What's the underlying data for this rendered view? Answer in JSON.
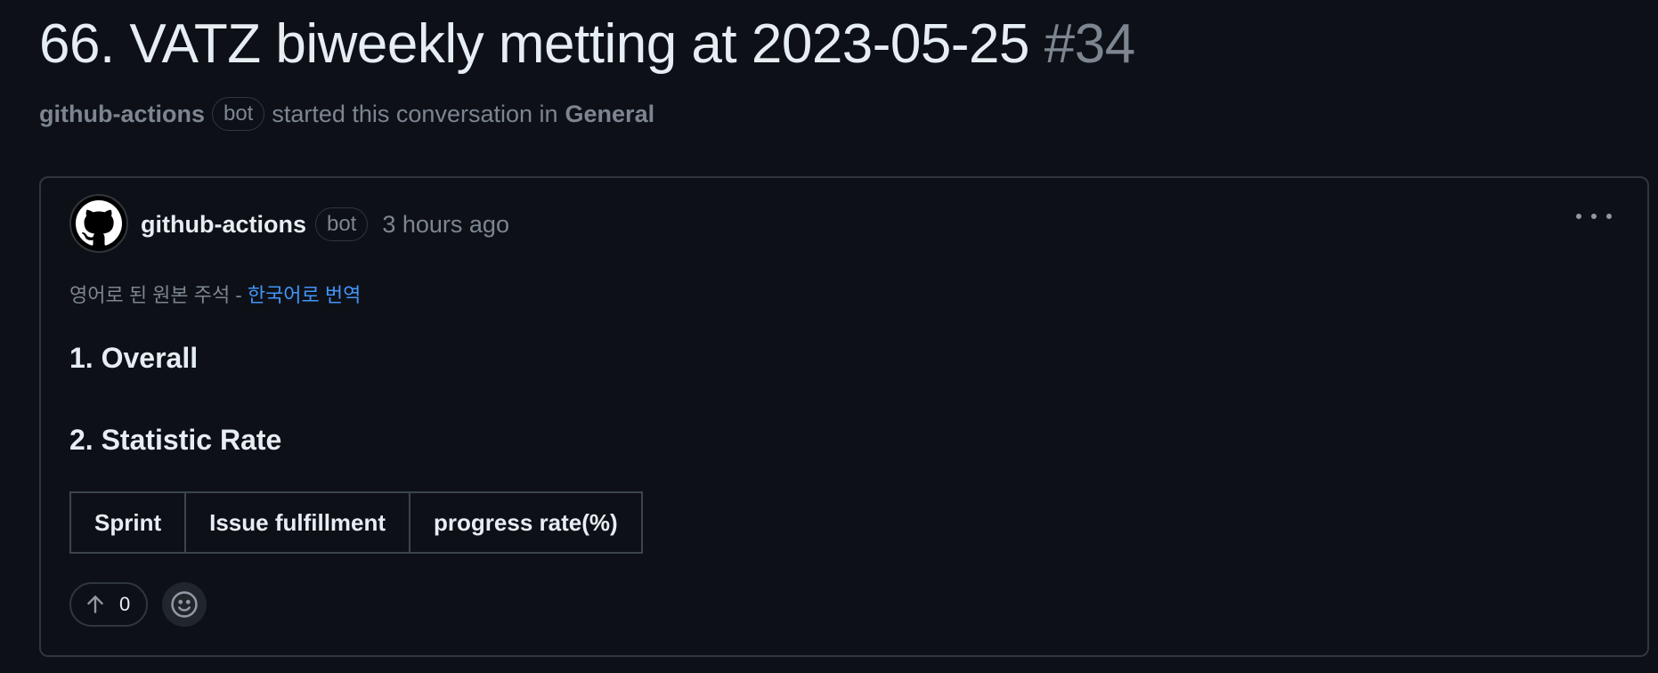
{
  "discussion": {
    "title": "66. VATZ biweekly metting at 2023-05-25",
    "number": "#34",
    "starter": "github-actions",
    "starter_badge": "bot",
    "started_text": "started this conversation in",
    "category": "General"
  },
  "comment": {
    "author": "github-actions",
    "author_badge": "bot",
    "time": "3 hours ago",
    "translation_note": "영어로 된 원본 주석 -",
    "translation_link": "한국어로 번역",
    "heading_1": "1. Overall",
    "heading_2": "2. Statistic Rate",
    "table": {
      "columns": [
        "Sprint",
        "Issue fulfillment",
        "progress rate(%)"
      ]
    },
    "upvotes": "0"
  },
  "icons": {
    "avatar": "github-octocat-icon",
    "more": "kebab-horizontal-icon",
    "upvote": "arrow-up-icon",
    "emoji": "smiley-icon"
  },
  "colors": {
    "background": "#0d1117",
    "border": "#30363d",
    "text": "#e6edf3",
    "muted": "#7d8590",
    "link": "#4493f8"
  }
}
